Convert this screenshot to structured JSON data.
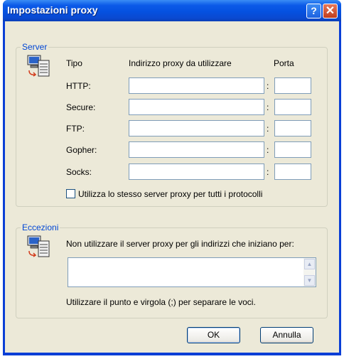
{
  "window": {
    "title": "Impostazioni proxy"
  },
  "servers": {
    "group_label": "Server",
    "col_type": "Tipo",
    "col_address": "Indirizzo proxy da utilizzare",
    "col_port": "Porta",
    "rows": [
      {
        "label": "HTTP:",
        "address": "",
        "port": ""
      },
      {
        "label": "Secure:",
        "address": "",
        "port": ""
      },
      {
        "label": "FTP:",
        "address": "",
        "port": ""
      },
      {
        "label": "Gopher:",
        "address": "",
        "port": ""
      },
      {
        "label": "Socks:",
        "address": "",
        "port": ""
      }
    ],
    "colon": ":",
    "same_proxy_label": "Utilizza lo stesso server proxy per tutti i protocolli",
    "same_proxy_checked": false
  },
  "exceptions": {
    "group_label": "Eccezioni",
    "description": "Non utilizzare il server proxy per gli indirizzi che iniziano per:",
    "value": "",
    "hint": "Utilizzare il punto e virgola (;) per separare le voci."
  },
  "buttons": {
    "ok": "OK",
    "cancel": "Annulla"
  },
  "icons": {
    "help": "help-icon",
    "close": "close-icon",
    "server": "network-computer-icon"
  }
}
